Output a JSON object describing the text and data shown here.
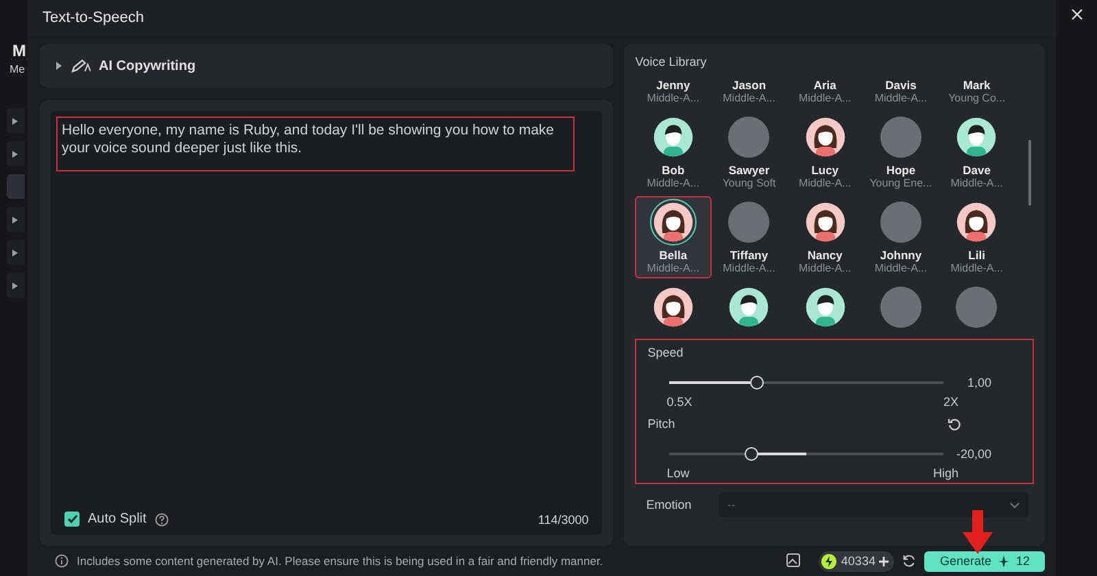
{
  "background_app": {
    "title": "M",
    "tab": "Me",
    "sidebar": [
      {
        "selected": false
      },
      {
        "selected": false
      },
      {
        "selected": true
      },
      {
        "selected": false
      },
      {
        "selected": false
      },
      {
        "selected": false
      }
    ]
  },
  "window": {
    "title": "Text-to-Speech"
  },
  "ai_copywriting": {
    "label": "AI Copywriting",
    "expanded": false
  },
  "editor": {
    "value": "Hello everyone, my name is Ruby, and today I'll be showing you how to make your voice sound deeper just like this.",
    "highlighted": true,
    "auto_split": {
      "label": "Auto Split",
      "checked": true
    },
    "counter": "114/3000"
  },
  "voice_library": {
    "title": "Voice Library",
    "rows": [
      [
        {
          "name": "Jenny",
          "description": "Middle-A...",
          "selected": false
        },
        {
          "name": "Jason",
          "description": "Middle-A...",
          "selected": false
        },
        {
          "name": "Aria",
          "description": "Middle-A...",
          "selected": false
        },
        {
          "name": "Davis",
          "description": "Middle-A...",
          "selected": false
        },
        {
          "name": "Mark",
          "description": "Young Co...",
          "selected": false
        }
      ],
      [
        {
          "name": "Bob",
          "description": "Middle-A...",
          "kind": "man",
          "selected": false
        },
        {
          "name": "Sawyer",
          "description": "Young Soft",
          "kind": "photo",
          "selected": false
        },
        {
          "name": "Lucy",
          "description": "Middle-A...",
          "kind": "woman",
          "selected": false
        },
        {
          "name": "Hope",
          "description": "Young Ene...",
          "kind": "photo",
          "selected": false
        },
        {
          "name": "Dave",
          "description": "Middle-A...",
          "kind": "man",
          "selected": false
        }
      ],
      [
        {
          "name": "Bella",
          "description": "Middle-A...",
          "kind": "woman",
          "selected": true,
          "highlighted": true
        },
        {
          "name": "Tiffany",
          "description": "Middle-A...",
          "kind": "photo",
          "selected": false
        },
        {
          "name": "Nancy",
          "description": "Middle-A...",
          "kind": "woman",
          "selected": false
        },
        {
          "name": "Johnny",
          "description": "Middle-A...",
          "kind": "photo",
          "selected": false
        },
        {
          "name": "Lili",
          "description": "Middle-A...",
          "kind": "woman",
          "selected": false
        }
      ],
      [
        {
          "kind": "woman",
          "selected": false
        },
        {
          "kind": "man",
          "selected": false
        },
        {
          "kind": "man",
          "selected": false
        },
        {
          "kind": "photo",
          "selected": false
        },
        {
          "kind": "photo",
          "selected": false
        }
      ]
    ]
  },
  "settings": {
    "highlighted": true,
    "sliders": [
      {
        "label": "Speed",
        "kind": "normal",
        "level": 0.32,
        "reading": "1,00",
        "min_label": "0.5X",
        "max_label": "2X"
      },
      {
        "label": "Pitch",
        "kind": "bipolar",
        "level": 0.3,
        "reading": "-20,00",
        "min_label": "Low",
        "max_label": "High",
        "reset": true
      }
    ]
  },
  "emotion": {
    "label": "Emotion",
    "value": "--"
  },
  "footer": {
    "note": "Includes some content generated by AI. Please ensure this is being used in a fair and friendly manner.",
    "credits": "40334",
    "generate": {
      "label": "Generate",
      "cost": "12"
    }
  },
  "annotation_arrow": true
}
